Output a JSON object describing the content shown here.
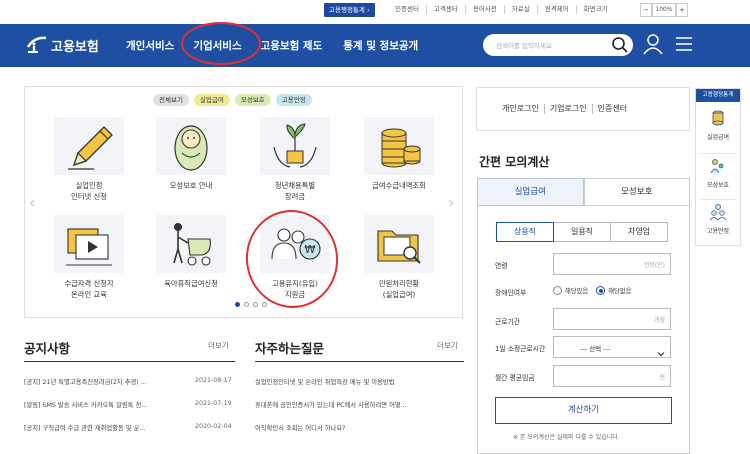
{
  "util": {
    "stat_button": "고용행정통계 ›",
    "links": [
      "인증센터",
      "고객센터",
      "용어사전",
      "자료실",
      "원격제어",
      "화면크기"
    ],
    "zoom": {
      "minus": "−",
      "value": "100%",
      "plus": "+"
    }
  },
  "header": {
    "logo_text": "고용보험",
    "menu": [
      "개인서비스",
      "기업서비스",
      "고용보험 제도",
      "통계 및 정보공개"
    ],
    "search_placeholder": "검색어를 입력하세요"
  },
  "services": {
    "filters": [
      "전체보기",
      "실업급여",
      "모성보호",
      "고용안정"
    ],
    "tiles": [
      {
        "label1": "실업인정",
        "label2": "인터넷 신청",
        "icon": "pencil-icon"
      },
      {
        "label1": "모성보호 안내",
        "label2": "",
        "icon": "baby-icon"
      },
      {
        "label1": "청년채용특별",
        "label2": "장려금",
        "icon": "sprout-hands-icon"
      },
      {
        "label1": "급여수급내역조회",
        "label2": "",
        "icon": "coins-icon"
      },
      {
        "label1": "수급자격 신청자",
        "label2": "온라인 교육",
        "icon": "video-icon"
      },
      {
        "label1": "육아휴직급여신청",
        "label2": "",
        "icon": "stroller-icon"
      },
      {
        "label1": "고용유지(유입)",
        "label2": "지원금",
        "icon": "people-won-icon"
      },
      {
        "label1": "민원처리현황",
        "label2": "(실업급여)",
        "icon": "folder-search-icon"
      }
    ]
  },
  "notice": {
    "title": "공지사항",
    "more": "더보기",
    "items": [
      {
        "text": "[공지] 21년 특별고용촉진장려금(2차 추경) ...",
        "date": "2021-08-17"
      },
      {
        "text": "[알림] SMS 발송 서비스 카카오톡 알림톡 전...",
        "date": "2021-07-19"
      },
      {
        "text": "[공지] 구직급여 수급 관련 재취업활동 및 운...",
        "date": "2020-02-04"
      }
    ]
  },
  "faq": {
    "title": "자주하는질문",
    "more": "더보기",
    "items": [
      "실업인정인터넷 및 온라인 취업특강 메뉴 및 이용방법",
      "휴대폰에 공인인증서가 있는데 PC에서 사용하려면 어떻...",
      "이직확인서 조회는 어디서 하나요?"
    ]
  },
  "login": {
    "links": [
      "개인로그인",
      "기업로그인",
      "인증센터"
    ]
  },
  "calc": {
    "title": "간편 모의계산",
    "tabs": [
      "실업급여",
      "모성보호"
    ],
    "subtabs": [
      "상용직",
      "일용직",
      "자영업"
    ],
    "age_label": "연령",
    "age_placeholder": "연령(만)",
    "disabled_label": "장애인여부",
    "radio_yes": "해당있음",
    "radio_no": "해당없음",
    "period_label": "근로기간",
    "period_placeholder": "개월",
    "hours_label": "1일 소정근로시간",
    "hours_select": "--- 선택 ---",
    "wage_label": "월간 평균임금",
    "wage_placeholder": "원",
    "button": "계산하기",
    "note": "※ 본 모의계산은 실제와 다를 수 있습니다."
  },
  "quick": {
    "title": "고용행정통계",
    "items": [
      "실업급여",
      "모성보호",
      "고용안정"
    ]
  },
  "colors": {
    "brand": "#1e4fa3",
    "annotation": "#e23030"
  }
}
